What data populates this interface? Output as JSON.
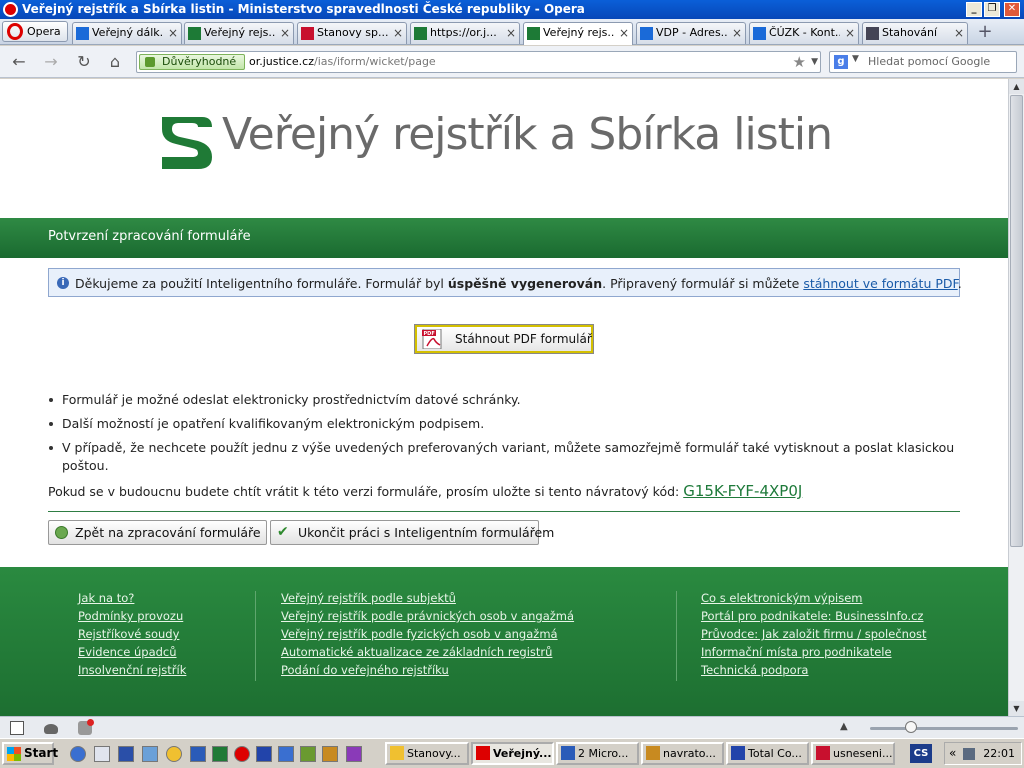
{
  "window": {
    "title": "Veřejný rejstřík a Sbírka listin - Ministerstvo spravedlnosti České republiky - Opera"
  },
  "browser": {
    "menu_label": "Opera",
    "tabs": [
      {
        "label": "Veřejný dálk...",
        "icon_color": "#1a6ad8"
      },
      {
        "label": "Veřejný rejs...",
        "icon_color": "#1d7a36"
      },
      {
        "label": "Stanovy sp...",
        "icon_color": "#c8102e"
      },
      {
        "label": "https://or.j...",
        "icon_color": "#1d7a36"
      },
      {
        "label": "Veřejný rejs...",
        "icon_color": "#1d7a36"
      },
      {
        "label": "VDP - Adres...",
        "icon_color": "#1a6ad8"
      },
      {
        "label": "ČÚZK - Kont...",
        "icon_color": "#1a6ad8"
      },
      {
        "label": "Stahování",
        "icon_color": "#445"
      }
    ],
    "trusted_label": "Důvěryhodné",
    "url_domain": "or.justice.cz",
    "url_path": "/ias/iform/wicket/page",
    "search_placeholder": "Hledat pomocí Google"
  },
  "page": {
    "site_title": "Veřejný rejstřík a Sbírka listin",
    "section_title": "Potvrzení zpracování formuláře",
    "info": {
      "pre": "Děkujeme za použití Inteligentního formuláře. Formulář byl ",
      "bold": "úspěšně vygenerován",
      "mid": ". Připravený formulář si můžete ",
      "link": "stáhnout ve formátu PDF",
      "post": "."
    },
    "pdf_button": "Stáhnout PDF formulář",
    "bullets": [
      "Formulář je možné odeslat elektronicky prostřednictvím datové schránky.",
      "Další možností je opatření kvalifikovaným elektronickým podpisem.",
      "V případě, že nechcete použít jednu z výše uvedených preferovaných variant, můžete samozřejmě formulář také vytisknout a poslat klasickou poštou."
    ],
    "return_text": "Pokud se v budoucnu budete chtít vrátit k této verzi formuláře, prosím uložte si tento návratový kód:",
    "return_code": "G15K-FYF-4XP0J",
    "back_button": "Zpět na zpracování formuláře",
    "finish_button": "Ukončit práci s Inteligentním formulářem"
  },
  "footer": {
    "col1": [
      "Jak na to?",
      "Podmínky provozu",
      "Rejstříkové soudy",
      "Evidence úpadců",
      "Insolvenční rejstřík"
    ],
    "col2": [
      "Veřejný rejstřík podle subjektů",
      "Veřejný rejstřík podle právnických osob v angažmá",
      "Veřejný rejstřík podle fyzických osob v angažmá",
      "Automatické aktualizace ze základních registrů",
      "Podání do veřejného rejstříku"
    ],
    "col3": [
      "Co s elektronickým výpisem",
      "Portál pro podnikatele: BusinessInfo.cz",
      "Průvodce: Jak založit firmu / společnost",
      "Informační místa pro podnikatele",
      "Technická podpora"
    ]
  },
  "taskbar": {
    "start_label": "Start",
    "items": [
      {
        "label": "Stanovy...",
        "active": false
      },
      {
        "label": "Veřejný...",
        "active": true
      },
      {
        "label": "2 Micro...",
        "active": false
      },
      {
        "label": "navrato...",
        "active": false
      },
      {
        "label": "Total Co...",
        "active": false
      },
      {
        "label": "usneseni...",
        "active": false
      }
    ],
    "lang": "CS",
    "clock": "22:01"
  },
  "colors": {
    "brand_green": "#1f7a36",
    "link_blue": "#1a5ba8"
  }
}
